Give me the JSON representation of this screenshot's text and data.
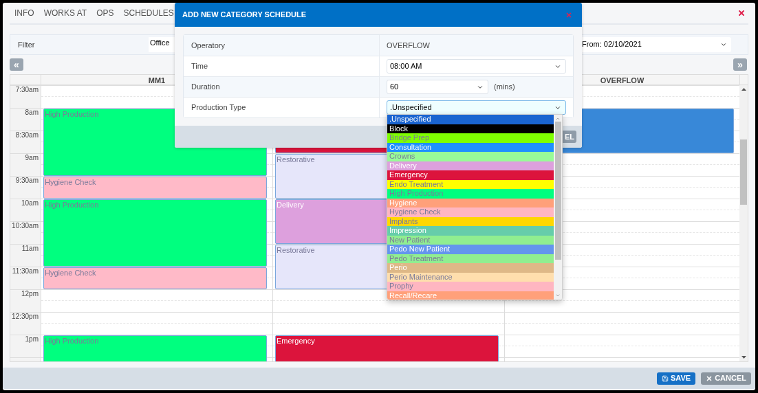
{
  "tabs": [
    {
      "label": "INFO"
    },
    {
      "label": "WORKS AT"
    },
    {
      "label": "OPS"
    },
    {
      "label": "SCHEDULES"
    }
  ],
  "filter": {
    "label": "Filter",
    "office": {
      "value": "Office"
    },
    "from": {
      "value": "From: 02/10/2021"
    }
  },
  "nav": {
    "prev": "«",
    "next": "»"
  },
  "calendar": {
    "columns": [
      {
        "header": "MM1"
      },
      {},
      {
        "header": "OVERFLOW"
      }
    ],
    "rows": [
      {
        "time": "7:30am",
        "cells": [
          {
            "kind": "empty"
          },
          {
            "kind": "empty"
          },
          {
            "kind": "empty"
          }
        ]
      },
      {
        "time": "8am",
        "cells": [
          {
            "kind": "start",
            "label": "High Production",
            "color": "#00ff7f"
          },
          {
            "kind": "start",
            "color": "#dc143c"
          },
          {
            "kind": "start",
            "color": "#3888d8"
          }
        ]
      },
      {
        "time": "8:30am",
        "cells": [
          {
            "kind": "continue"
          },
          {
            "kind": "continue"
          },
          {
            "kind": "continue"
          }
        ]
      },
      {
        "time": "9am",
        "cells": [
          {
            "kind": "continue"
          },
          {
            "kind": "start",
            "label": "Restorative",
            "color": "#e6e6fa"
          },
          {
            "kind": "empty"
          }
        ]
      },
      {
        "time": "9:30am",
        "cells": [
          {
            "kind": "start",
            "label": "Hygiene Check",
            "color": "#ffbac8"
          },
          {
            "kind": "continue"
          },
          {
            "kind": "empty"
          }
        ]
      },
      {
        "time": "10am",
        "cells": [
          {
            "kind": "start",
            "label": "High Production",
            "color": "#00ff7f"
          },
          {
            "kind": "start",
            "label": "Delivery",
            "color": "#dda0dd"
          },
          {
            "kind": "empty"
          }
        ]
      },
      {
        "time": "10:30am",
        "cells": [
          {
            "kind": "continue"
          },
          {
            "kind": "continue"
          },
          {
            "kind": "empty"
          }
        ]
      },
      {
        "time": "11am",
        "cells": [
          {
            "kind": "continue"
          },
          {
            "kind": "start",
            "label": "Restorative",
            "color": "#e6e6fa"
          },
          {
            "kind": "empty"
          }
        ]
      },
      {
        "time": "11:30am",
        "cells": [
          {
            "kind": "start",
            "label": "Hygiene Check",
            "color": "#ffbac8"
          },
          {
            "kind": "continue"
          },
          {
            "kind": "empty"
          }
        ]
      },
      {
        "time": "12pm",
        "cells": [
          {
            "kind": "empty"
          },
          {
            "kind": "empty"
          },
          {
            "kind": "empty"
          }
        ]
      },
      {
        "time": "12:30pm",
        "cells": [
          {
            "kind": "empty"
          },
          {
            "kind": "empty"
          },
          {
            "kind": "empty"
          }
        ]
      },
      {
        "time": "1pm",
        "cells": [
          {
            "kind": "start",
            "label": "High Production",
            "color": "#00ff7f"
          },
          {
            "kind": "start",
            "label": "Emergency",
            "color": "#dc143c"
          },
          {
            "kind": "empty"
          }
        ]
      },
      {
        "cells": [
          {
            "kind": "continue"
          },
          {
            "kind": "continue"
          },
          {
            "kind": "empty"
          }
        ]
      }
    ]
  },
  "dialog": {
    "title": "ADD NEW CATEGORY SCHEDULE",
    "fields": [
      {
        "label": "Operatory",
        "kind": "text",
        "value": "OVERFLOW"
      },
      {
        "label": "Time",
        "kind": "select",
        "value": "08:00 AM",
        "focused": false
      },
      {
        "label": "Duration",
        "kind": "select",
        "value": "60",
        "unit": "(mins)",
        "focused": false
      },
      {
        "label": "Production Type",
        "kind": "select",
        "value": ".Unspecified",
        "focused": true
      }
    ],
    "footer_button": "EL",
    "options": [
      {
        "label": ".Unspecified",
        "selected": true
      },
      {
        "label": "Block",
        "color": "#000000",
        "selected": false
      },
      {
        "label": "Bridge Prep",
        "color": "#7fff00",
        "selected": false
      },
      {
        "label": "Consultation",
        "color": "#1e90ff",
        "selected": false
      },
      {
        "label": "Crowns",
        "color": "#98fb98",
        "selected": false
      },
      {
        "label": "Delivery",
        "color": "#dda0dd",
        "selected": false
      },
      {
        "label": "Emergency",
        "color": "#dc143c",
        "selected": false
      },
      {
        "label": "Endo Treatment",
        "color": "#ffff00",
        "selected": false
      },
      {
        "label": "High Production",
        "color": "#00ff7f",
        "selected": false
      },
      {
        "label": "Hygiene",
        "color": "#ffa07a",
        "selected": false
      },
      {
        "label": "Hygiene Check",
        "color": "#ffb6c1",
        "selected": false
      },
      {
        "label": "Implants",
        "color": "#ffd700",
        "selected": false
      },
      {
        "label": "Impression",
        "color": "#66cdaa",
        "selected": false
      },
      {
        "label": "New Patient",
        "color": "#90ee90",
        "selected": false
      },
      {
        "label": "Pedo New Patient",
        "color": "#6495ed",
        "selected": false
      },
      {
        "label": "Pedo Treatment",
        "color": "#90ee90",
        "selected": false
      },
      {
        "label": "Perio",
        "color": "#deb887",
        "selected": false
      },
      {
        "label": "Perio Maintenance",
        "color": "#ffdead",
        "selected": false
      },
      {
        "label": "Prophy",
        "color": "#ffb6c1",
        "selected": false
      },
      {
        "label": "Recall/Recare",
        "color": "#ffa07a",
        "selected": false
      }
    ]
  },
  "footer": {
    "buttons": [
      {
        "label": "SAVE",
        "kind": "primary"
      },
      {
        "label": "CANCEL",
        "kind": "secondary"
      }
    ]
  }
}
